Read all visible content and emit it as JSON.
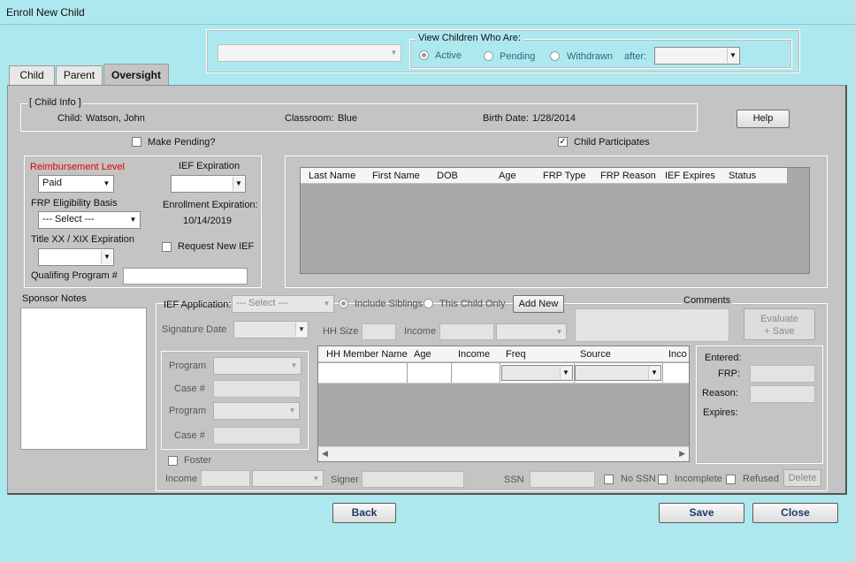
{
  "window": {
    "title": "Enroll New Child"
  },
  "filter": {
    "child_select_value": "",
    "group_label": "View Children Who Are:",
    "radio_active": "Active",
    "radio_pending": "Pending",
    "radio_withdrawn": "Withdrawn",
    "after_label": "after:",
    "after_value": ""
  },
  "tabs": [
    "Child",
    "Parent",
    "Oversight"
  ],
  "child_info": {
    "group_label": "[ Child Info ]",
    "child_label": "Child:",
    "child_value": "Watson, John",
    "classroom_label": "Classroom:",
    "classroom_value": "Blue",
    "birth_label": "Birth Date:",
    "birth_value": "1/28/2014",
    "help_label": "Help"
  },
  "make_pending_label": "Make Pending?",
  "child_participates_label": "Child Participates",
  "reimbursement": {
    "level_label": "Reimbursement Level",
    "level_value": "Paid",
    "ief_expiration_label": "IEF Expiration",
    "ief_expiration_value": "",
    "frp_basis_label": "FRP Eligibility Basis",
    "frp_basis_value": "--- Select ---",
    "enrollment_exp_label": "Enrollment Expiration:",
    "enrollment_exp_value": "10/14/2019",
    "title_xx_label": "Title XX / XIX Expiration",
    "title_xx_value": "",
    "request_ief_label": "Request New IEF",
    "qualifying_label": "Qualifing Program #",
    "qualifying_value": ""
  },
  "siblings_grid": {
    "columns": [
      "Last Name",
      "First Name",
      "DOB",
      "Age",
      "FRP Type",
      "FRP Reason",
      "IEF Expires",
      "Status"
    ],
    "rows": []
  },
  "sponsor_notes": {
    "label": "Sponsor Notes",
    "value": ""
  },
  "ief_app": {
    "label": "IEF Application:",
    "select_value": "--- Select ---",
    "include_siblings": "Include Siblings",
    "this_child_only": "This Child Only",
    "add_new": "Add New",
    "comments_label": "Comments",
    "evaluate_save": "Evaluate + Save",
    "signature_date_label": "Signature Date",
    "hh_size_label": "HH Size",
    "income_label": "Income",
    "program_label_1": "Program",
    "case_label_1": "Case #",
    "program_label_2": "Program",
    "case_label_2": "Case #",
    "foster_label": "Foster",
    "income_label_2": "Income",
    "signer_label": "Signer",
    "ssn_label": "SSN",
    "no_ssn_label": "No SSN",
    "incomplete_label": "Incomplete",
    "refused_label": "Refused",
    "delete_label": "Delete"
  },
  "hh_grid": {
    "columns": [
      "HH Member Name",
      "Age",
      "Income",
      "Freq",
      "Source",
      "Inco"
    ]
  },
  "entered_panel": {
    "entered_label": "Entered:",
    "frp_label": "FRP:",
    "reason_label": "Reason:",
    "expires_label": "Expires:"
  },
  "footer": {
    "back": "Back",
    "save": "Save",
    "close": "Close"
  },
  "colors": {
    "background": "#aee8ef",
    "panel": "#c4c4c4",
    "reimbursement_label": "#e00000",
    "accent_text": "#1a3a6a"
  }
}
